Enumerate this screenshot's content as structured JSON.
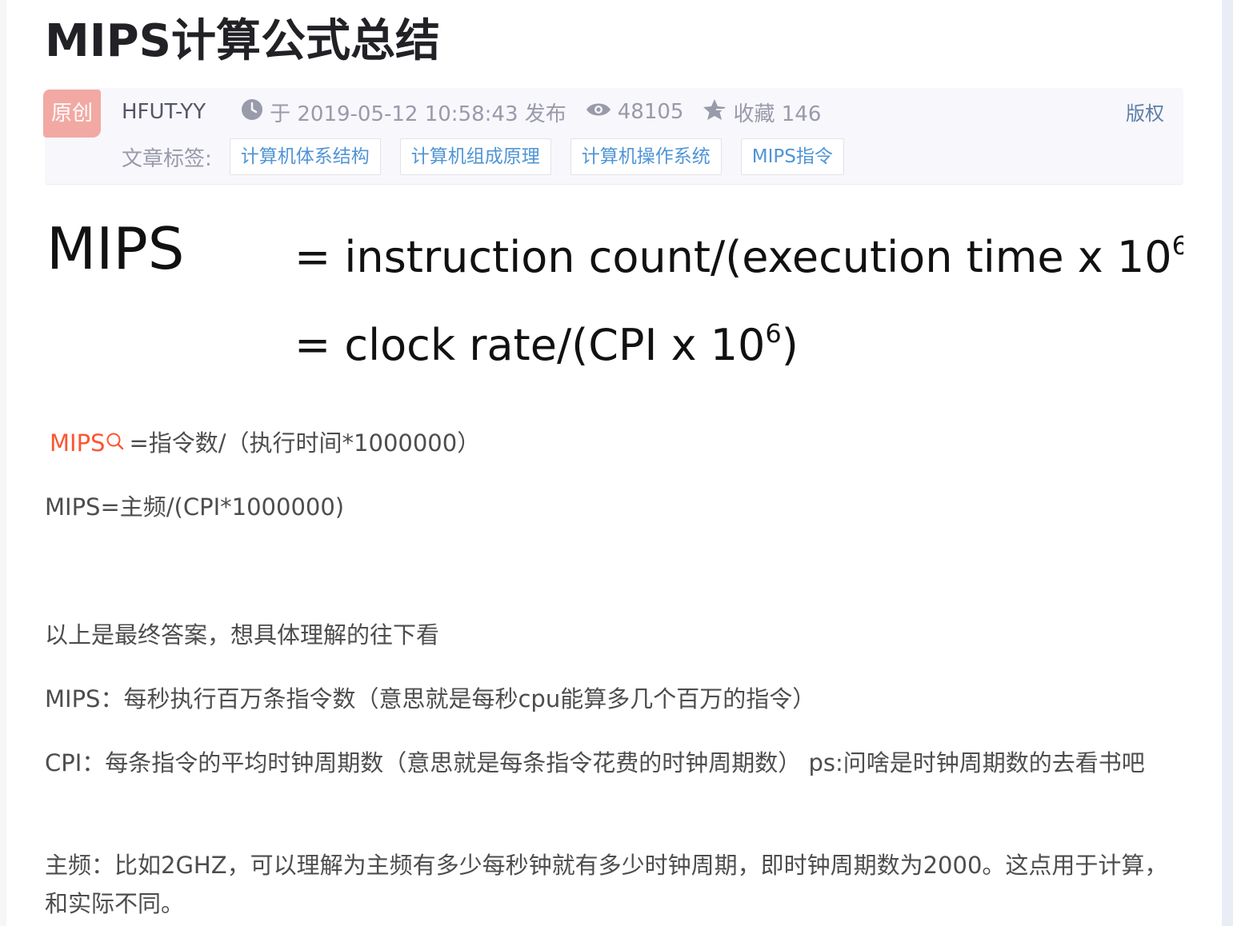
{
  "article": {
    "title": "MIPS计算公式总结",
    "meta": {
      "badge": "原创",
      "author": "HFUT-YY",
      "published": "于 2019-05-12 10:58:43 发布",
      "views": "48105",
      "favorites": "收藏 146",
      "copyright": "版权",
      "tags_label": "文章标签:",
      "tags": [
        "计算机体系结构",
        "计算机组成原理",
        "计算机操作系统",
        "MIPS指令"
      ]
    },
    "formula": {
      "lhs": "MIPS",
      "line1": "= instruction count/(execution time x 10",
      "line2": "= clock rate/(CPI x 10",
      "exponent": "6",
      "close_paren": ")"
    },
    "body": {
      "p1_link": "MIPS",
      "p1_text": "=指令数/（执行时间*1000000）",
      "p2": "MIPS=主频/(CPI*1000000)",
      "p3": "以上是最终答案，想具体理解的往下看",
      "p4": "MIPS：每秒执行百万条指令数（意思就是每秒cpu能算多几个百万的指令）",
      "p5": "CPI：每条指令的平均时钟周期数（意思就是每条指令花费的时钟周期数） ps:问啥是时钟周期数的去看书吧",
      "p6": "主频：比如2GHZ，可以理解为主频有多少每秒钟就有多少时钟周期，即时钟周期数为2000。这点用于计算，和实际不同。"
    }
  },
  "icons": {
    "clock": "clock-icon",
    "views": "eye-icon",
    "favorites": "star-icon",
    "search": "search-icon"
  },
  "colors": {
    "title": "#222226",
    "meta_text": "#999aaa",
    "tag_text": "#5094d5",
    "badge_bg": "#f2a9a3",
    "link_red": "#fc5531",
    "body_text": "#4d4d4d",
    "copyright": "#5f7fa7"
  }
}
